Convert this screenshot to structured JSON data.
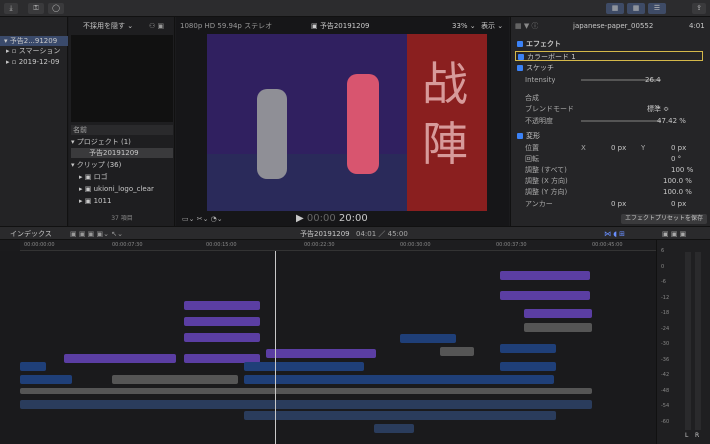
{
  "toolbar": {
    "import_icon": "download-icon",
    "keys_icon": "key-icon",
    "bg_icon": "circle-icon",
    "share_icon": "share-icon"
  },
  "library": {
    "items": [
      {
        "label": "予告2...91209"
      },
      {
        "label": "スマーション"
      },
      {
        "label": "2019-12-09"
      }
    ]
  },
  "browser": {
    "filter": "不採用を隠す",
    "section_label": "名前",
    "project_header": "プロジェクト",
    "project_count": "(1)",
    "project_name": "予告20191209",
    "clips_header": "クリップ",
    "clips_count": "(36)",
    "clips": [
      "ロゴ",
      "ukioni_logo_clear",
      "1011"
    ],
    "item_count": "37 項目"
  },
  "viewer": {
    "format": "1080p HD 59.94p ステレオ",
    "title": "予告20191209",
    "zoom": "33%",
    "view_label": "表示",
    "timecode_dim": "00:00",
    "timecode": "20:00"
  },
  "inspector": {
    "clip_name": "japanese-paper_00552",
    "duration": "4:01",
    "sections": {
      "effects": "エフェクト",
      "color_board": "カラーボード 1",
      "sketch": "スケッチ",
      "intensity_label": "Intensity",
      "intensity_value": "26.4",
      "composite": "合成",
      "blend_mode_label": "ブレンドモード",
      "blend_mode_value": "標準 ≎",
      "opacity_label": "不透明度",
      "opacity_value": "47.42 %",
      "transform": "変形",
      "position_label": "位置",
      "pos_x": "0 px",
      "pos_y": "0 px",
      "rotation_label": "回転",
      "rotation_value": "0 °",
      "scale_all_label": "調整 (すべて)",
      "scale_all_value": "100 %",
      "scale_x_label": "調整 (X 方向)",
      "scale_x_value": "100.0 %",
      "scale_y_label": "調整 (Y 方向)",
      "scale_y_value": "100.0 %",
      "anchor_label": "アンカー",
      "anchor_x": "0 px",
      "anchor_y": "0 px",
      "x": "X",
      "y": "Y"
    },
    "save_preset": "エフェクトプリセットを保存"
  },
  "timeline": {
    "index": "インデックス",
    "project": "予告20191209",
    "position": "04:01 ／ 45:00",
    "ruler": [
      "00:00:00:00",
      "00:00:07:30",
      "00:00:15:00",
      "00:00:22:30",
      "00:00:30:00",
      "00:00:37:30",
      "00:00:45:00"
    ]
  },
  "meters": {
    "labels": [
      "6",
      "0",
      "-6",
      "-12",
      "-18",
      "-24",
      "-30",
      "-36",
      "-42",
      "-48",
      "-54",
      "-60"
    ],
    "left": "L",
    "right": "R"
  }
}
